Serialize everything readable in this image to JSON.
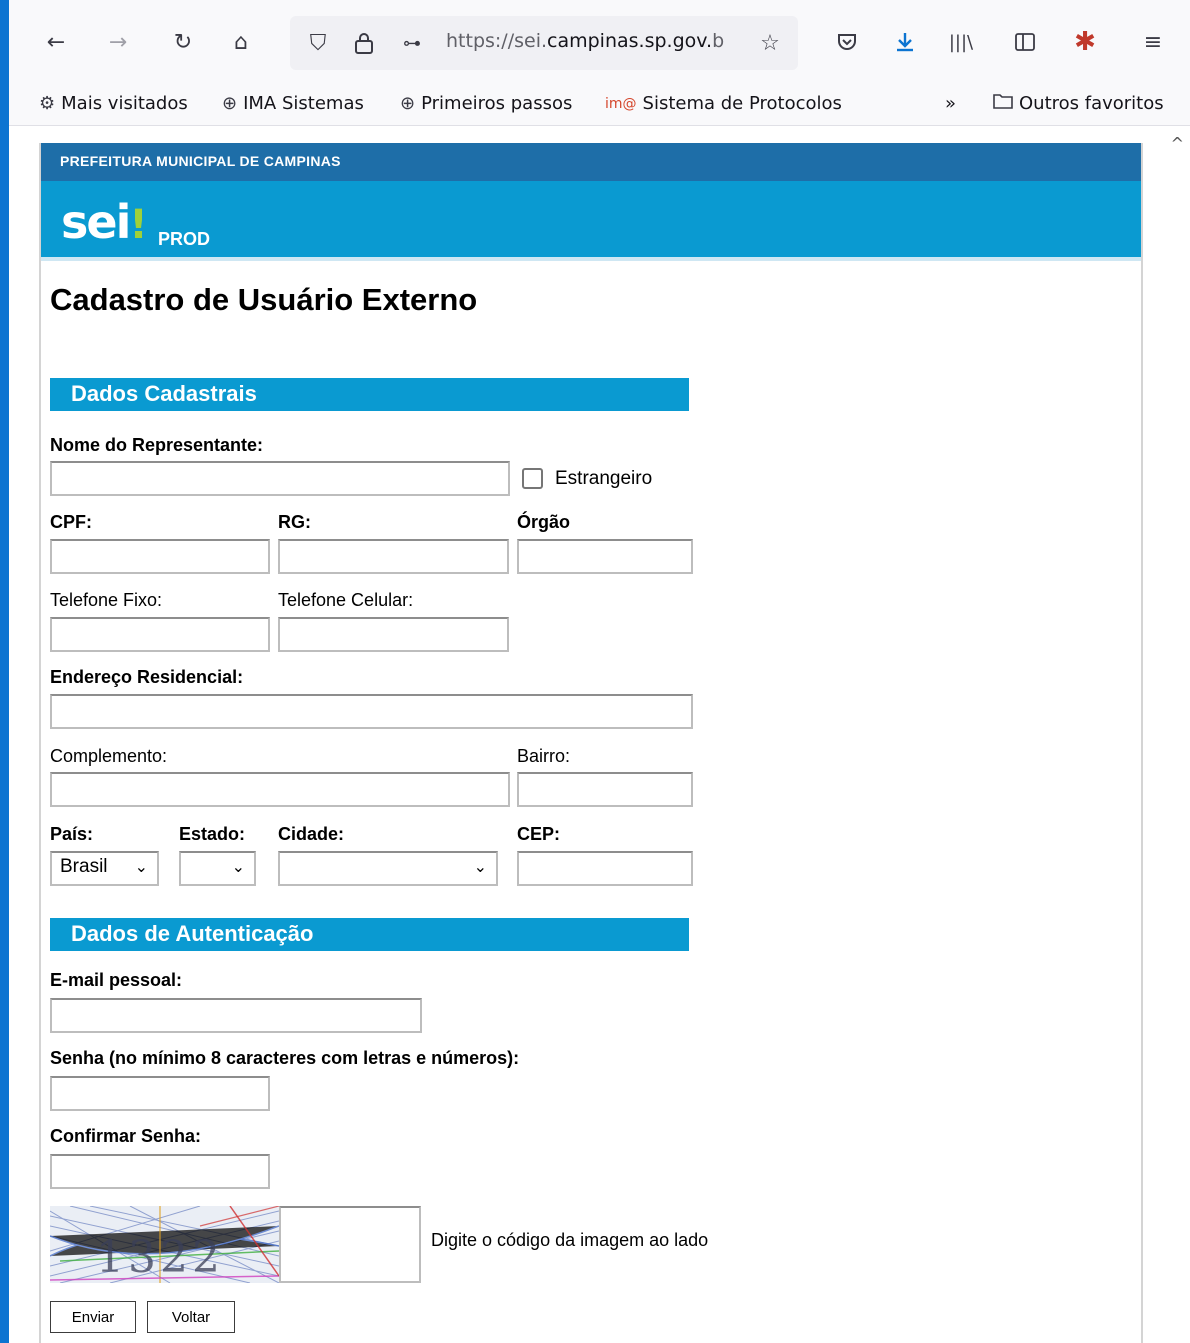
{
  "browser": {
    "url_prefix": "https://sei.",
    "url_domain": "campinas.sp.gov.",
    "url_suffix": "b",
    "bookmarks": [
      {
        "label": "Mais visitados",
        "icon": "gear-icon"
      },
      {
        "label": "IMA Sistemas",
        "icon": "globe-icon"
      },
      {
        "label": "Primeiros passos",
        "icon": "globe-icon"
      },
      {
        "label": "Sistema de Protocolos",
        "icon": "ima-logo-icon"
      }
    ],
    "overflow": "»",
    "other_bookmarks": "Outros favoritos"
  },
  "header": {
    "agency": "PREFEITURA MUNICIPAL DE CAMPINAS",
    "logo_text": "sei",
    "logo_bang": "!",
    "env": "PROD"
  },
  "page": {
    "title": "Cadastro de Usuário Externo"
  },
  "sections": {
    "cadastrais": "Dados Cadastrais",
    "autenticacao": "Dados de Autenticação"
  },
  "labels": {
    "nome": "Nome do Representante:",
    "estrangeiro": "Estrangeiro",
    "cpf": "CPF:",
    "rg": "RG:",
    "orgao": "Órgão",
    "tel_fixo": "Telefone Fixo:",
    "tel_cel": "Telefone Celular:",
    "endereco": "Endereço Residencial:",
    "complemento": "Complemento:",
    "bairro": "Bairro:",
    "pais": "País:",
    "estado": "Estado:",
    "cidade": "Cidade:",
    "cep": "CEP:",
    "email": "E-mail pessoal:",
    "senha": "Senha (no mínimo 8 caracteres com letras e números):",
    "confirmar": "Confirmar Senha:",
    "captcha_hint": "Digite o código da imagem ao lado"
  },
  "selects": {
    "pais": "Brasil",
    "estado": "",
    "cidade": ""
  },
  "captcha": {
    "code": "1322"
  },
  "buttons": {
    "enviar": "Enviar",
    "voltar": "Voltar"
  }
}
